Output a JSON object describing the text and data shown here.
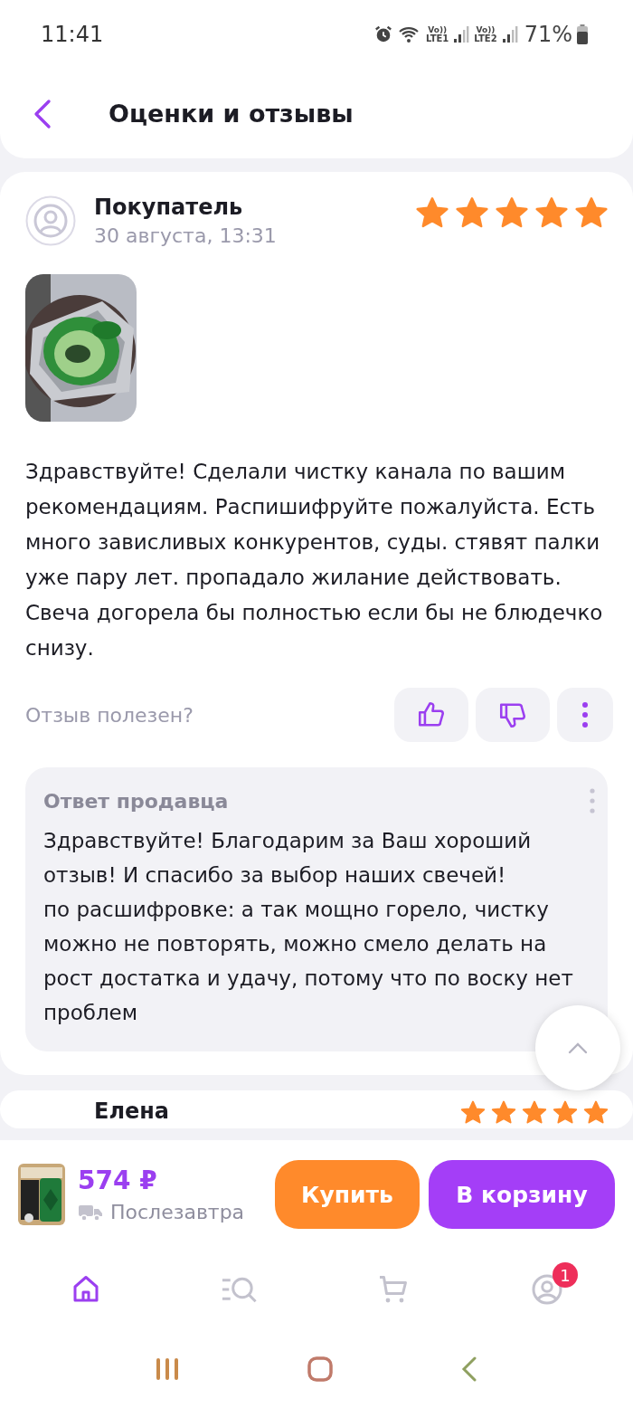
{
  "status_bar": {
    "time": "11:41",
    "sims": [
      {
        "volte": "Vo))",
        "label": "LTE1"
      },
      {
        "volte": "Vo))",
        "label": "LTE2"
      }
    ],
    "battery": "71%"
  },
  "header": {
    "title": "Оценки и отзывы"
  },
  "reviews": [
    {
      "author": "Покупатель",
      "date": "30 августа, 13:31",
      "stars": 5,
      "photos": [
        {
          "kind": "picture"
        }
      ],
      "text": "Здравствуйте! Сделали чистку канала по вашим рекомендациям. Распишифруйте пожалуйста. Есть много зависливых конкурентов, суды. стявят палки уже пару лет. пропадало жилание действовать.  Свеча догорела бы полностью если бы не блюдечко снизу.",
      "helpful_label": "Отзыв полезен?",
      "reply": {
        "title": "Ответ продавца",
        "text": "Здравствуйте! Благодарим за Ваш хороший отзыв! И спасибо за выбор наших свечей!\nпо расшифровке: а так мощно горело, чистку можно не повторять, можно смело делать на рост достатка и удачу, потому что по воску нет проблем"
      }
    },
    {
      "author": "Елена",
      "stars": 5
    }
  ],
  "buy_bar": {
    "price": "574 ₽",
    "delivery": "Послезавтра",
    "buttons": [
      {
        "label": "Купить",
        "kind": "buy"
      },
      {
        "label": "В корзину",
        "kind": "cart"
      }
    ]
  },
  "tabs": [
    {
      "kind": "home",
      "selected": true
    },
    {
      "kind": "catalog",
      "selected": false
    },
    {
      "kind": "cart",
      "selected": false
    },
    {
      "kind": "profile",
      "selected": false,
      "badge": "1"
    }
  ]
}
